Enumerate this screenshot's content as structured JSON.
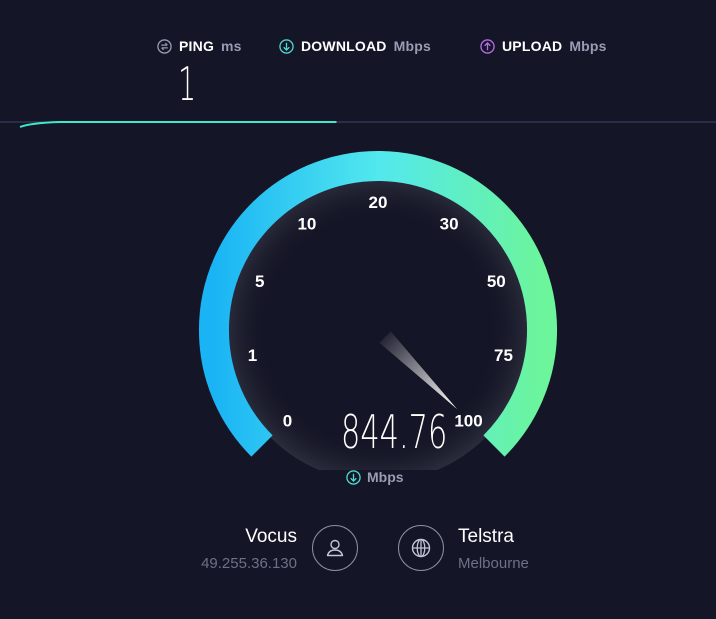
{
  "metrics": {
    "ping": {
      "label": "PING",
      "unit": "ms",
      "value": "1",
      "icon": "ping-icon",
      "color": "#9a9cb3"
    },
    "download": {
      "label": "DOWNLOAD",
      "unit": "Mbps",
      "icon": "download-arrow-icon",
      "color": "#4fd6d0"
    },
    "upload": {
      "label": "UPLOAD",
      "unit": "Mbps",
      "icon": "upload-arrow-icon",
      "color": "#b46ee6"
    }
  },
  "progress": {
    "fraction": 0.47,
    "color": "#3fe8c8"
  },
  "gauge": {
    "ticks": [
      "0",
      "1",
      "5",
      "10",
      "20",
      "30",
      "50",
      "75",
      "100"
    ],
    "value": "844.76",
    "unit": "Mbps",
    "needle_at": "100",
    "color_start": "#1ab4f5",
    "color_mid": "#52e8ee",
    "color_end": "#6cf59b"
  },
  "isp": {
    "name": "Vocus",
    "ip": "49.255.36.130",
    "icon": "user-icon"
  },
  "server": {
    "name": "Telstra",
    "location": "Melbourne",
    "icon": "globe-icon"
  }
}
